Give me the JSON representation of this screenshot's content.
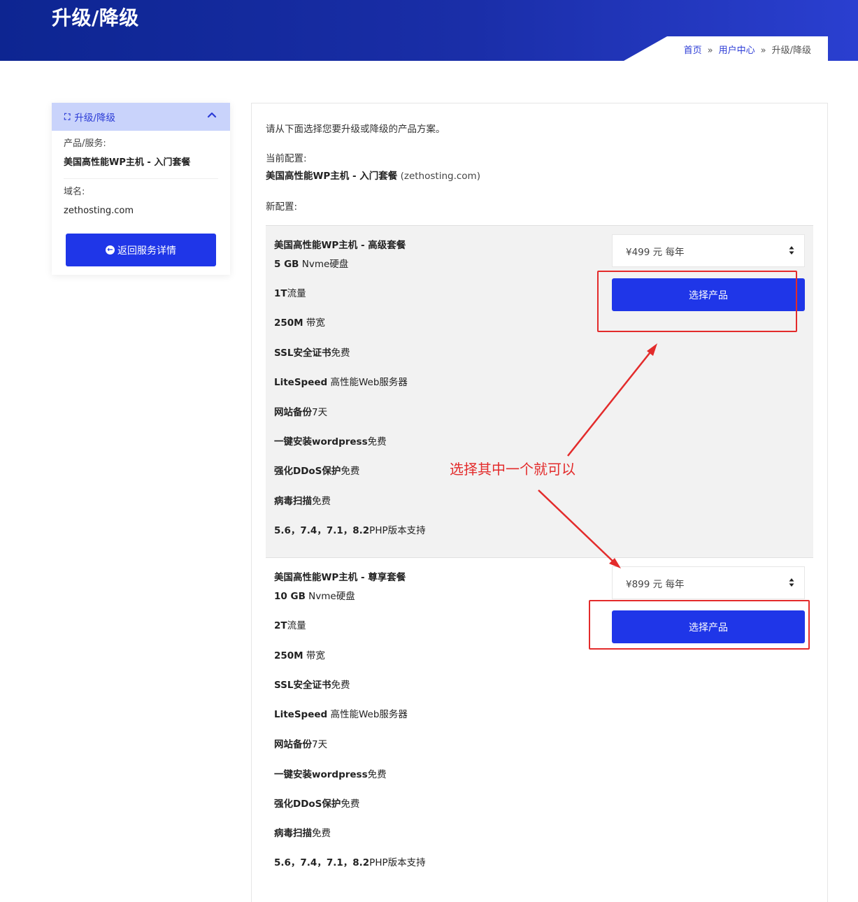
{
  "header": {
    "title": "升级/降级",
    "breadcrumb": [
      {
        "label": "首页",
        "link": true
      },
      {
        "label": "用户中心",
        "link": true
      },
      {
        "label": "升级/降级",
        "link": false
      }
    ],
    "breadcrumb_sep": "»"
  },
  "sidebar": {
    "header_title": "升级/降级",
    "product_label": "产品/服务:",
    "product_value": "美国高性能WP主机 - 入门套餐",
    "domain_label": "域名:",
    "domain_value": "zethosting.com",
    "back_button": "返回服务详情"
  },
  "main": {
    "intro": "请从下面选择您要升级或降级的产品方案。",
    "current_label": "当前配置:",
    "current_product": "美国高性能WP主机 - 入门套餐",
    "current_domain": "(zethosting.com)",
    "new_label": "新配置:"
  },
  "products": [
    {
      "name": "美国高性能WP主机 - 高级套餐",
      "cycle": "¥499 元 每年",
      "button": "选择产品",
      "features": [
        {
          "bold": "5 GB",
          "rest": " Nvme硬盘"
        },
        {
          "bold": "1T",
          "rest": "流量"
        },
        {
          "bold": "250M",
          "rest": " 带宽"
        },
        {
          "bold": "SSL安全证书",
          "rest": "免费"
        },
        {
          "bold": "LiteSpeed",
          "rest": " 高性能Web服务器"
        },
        {
          "bold": "网站备份",
          "rest": "7天"
        },
        {
          "bold": "一键安装wordpress",
          "rest": "免费"
        },
        {
          "bold": "强化DDoS保护",
          "rest": "免费"
        },
        {
          "bold": "病毒扫描",
          "rest": "免费"
        },
        {
          "bold": "5.6，7.4，7.1，8.2",
          "rest": "PHP版本支持"
        }
      ]
    },
    {
      "name": "美国高性能WP主机 - 尊享套餐",
      "cycle": "¥899 元 每年",
      "button": "选择产品",
      "features": [
        {
          "bold": "10 GB",
          "rest": " Nvme硬盘"
        },
        {
          "bold": "2T",
          "rest": "流量"
        },
        {
          "bold": "250M",
          "rest": " 带宽"
        },
        {
          "bold": "SSL安全证书",
          "rest": "免费"
        },
        {
          "bold": "LiteSpeed",
          "rest": " 高性能Web服务器"
        },
        {
          "bold": "网站备份",
          "rest": "7天"
        },
        {
          "bold": "一键安装wordpress",
          "rest": "免费"
        },
        {
          "bold": "强化DDoS保护",
          "rest": "免费"
        },
        {
          "bold": "病毒扫描",
          "rest": "免费"
        },
        {
          "bold": "5.6，7.4，7.1，8.2",
          "rest": "PHP版本支持"
        }
      ]
    }
  ],
  "annotation": {
    "text": "选择其中一个就可以",
    "color": "#e32b2b"
  },
  "colors": {
    "header_bg": "#0d2591",
    "accent": "#1f36e8",
    "sidebar_header_bg": "#c9d3fb"
  }
}
